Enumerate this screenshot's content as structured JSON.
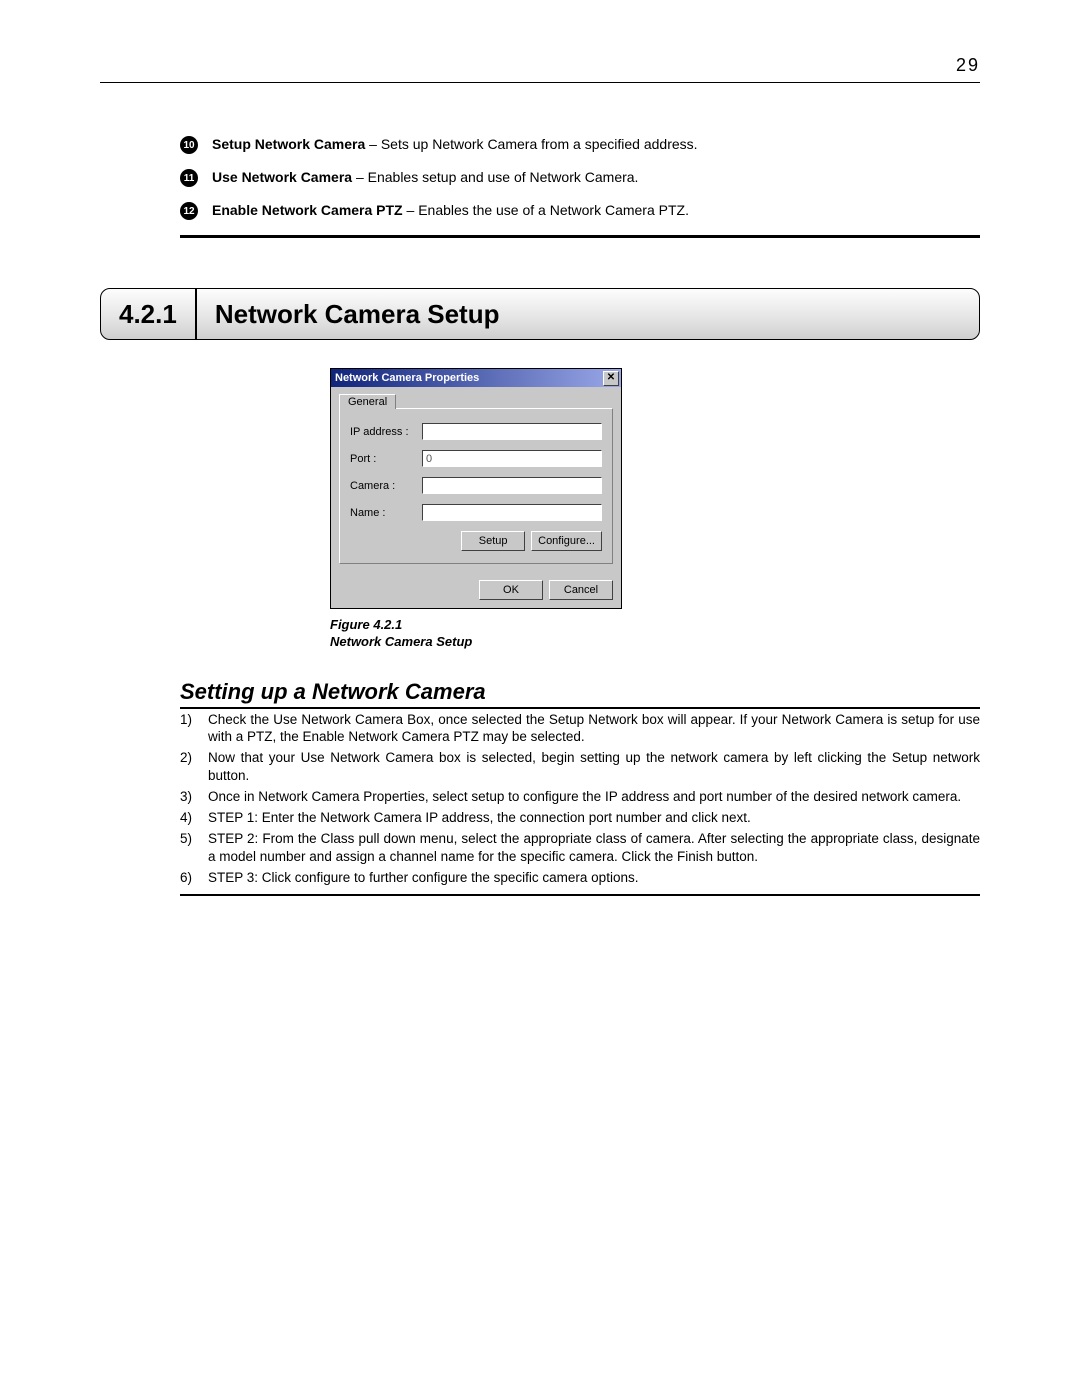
{
  "pageNumber": "29",
  "definitions": [
    {
      "num": "10",
      "term": "Setup Network Camera",
      "desc": " – Sets up Network Camera from a specified address."
    },
    {
      "num": "11",
      "term": "Use Network Camera ",
      "desc": " – Enables setup and use of Network Camera."
    },
    {
      "num": "12",
      "term": "Enable Network Camera PTZ ",
      "desc": " – Enables the use of a Network Camera PTZ."
    }
  ],
  "section": {
    "number": "4.2.1",
    "title": "Network Camera Setup"
  },
  "dialog": {
    "title": "Network Camera Properties",
    "closeGlyph": "✕",
    "tab": "General",
    "fields": {
      "ip": {
        "label": "IP address :",
        "value": ""
      },
      "port": {
        "label": "Port :",
        "value": "0"
      },
      "camera": {
        "label": "Camera :",
        "value": ""
      },
      "name": {
        "label": "Name :",
        "value": ""
      }
    },
    "buttons": {
      "setup": "Setup",
      "configure": "Configure...",
      "ok": "OK",
      "cancel": "Cancel"
    }
  },
  "figure": {
    "line1": "Figure 4.2.1",
    "line2": "Network Camera Setup"
  },
  "subheading": "Setting up a Network Camera",
  "steps": [
    {
      "n": "1)",
      "t": "Check the Use Network Camera Box, once selected the Setup Network box will appear. If your Network Camera is setup for use with a PTZ, the Enable Network Camera PTZ may be selected."
    },
    {
      "n": "2)",
      "t": "Now that your Use Network Camera box is selected, begin setting up the network camera by left clicking the Setup network button."
    },
    {
      "n": "3)",
      "t": "Once in Network Camera Properties, select setup to configure the IP address and port number of the desired network camera."
    },
    {
      "n": "4)",
      "t": "STEP 1: Enter the Network Camera IP address, the connection port number and click next."
    },
    {
      "n": "5)",
      "t": "STEP 2: From the Class pull down menu, select the appropriate class of camera. After selecting the appropriate class, designate a model number and assign a channel name for the specific camera. Click the Finish button."
    },
    {
      "n": "6)",
      "t": "STEP 3: Click configure to further configure the specific camera options."
    }
  ]
}
